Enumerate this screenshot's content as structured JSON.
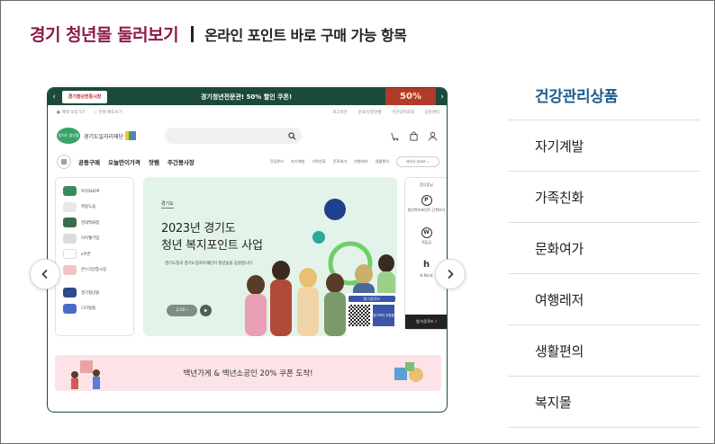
{
  "heading": {
    "title": "경기 청년몰 둘러보기",
    "subtitle": "온라인 포인트 바로 구매 가능 항목"
  },
  "carousel": {
    "prev_label": "‹",
    "next_label": "›",
    "screenshot": {
      "topbar": {
        "logo_text": "경기청년전통시장",
        "promo_text": "경기청년전문관! 50% 할인 쿠폰!",
        "promo_badge": "50%"
      },
      "utility_left": [
        "● 혜택 보증가기",
        "☆ 만원 페도보기"
      ],
      "utility_right": [
        "로그아웃",
        "문의/신청현황",
        "주문내역조회",
        "상담센터"
      ],
      "logo": {
        "badge": "경기도 청년몰",
        "name": "경기도일자리재단"
      },
      "nav_main": [
        "공동구매",
        "오늘만이가격",
        "찻템",
        "주간봉사장"
      ],
      "nav_sub": [
        "건강관리",
        "자기계발",
        "가족친화",
        "문화여가",
        "여행레저",
        "생활편의"
      ],
      "service_label": "서비스 zone ⌄",
      "sidebar": [
        {
          "label": "복지SHOP",
          "color": "#3a8b5a"
        },
        {
          "label": "위링도움",
          "color": "#e8e8e8"
        },
        {
          "label": "현대백화점",
          "color": "#3a6b4e"
        },
        {
          "label": "이지웰기업",
          "color": "#dcdcdc"
        },
        {
          "label": "e쿠폰",
          "color": "#ffffff"
        },
        {
          "label": "온누리전통시장",
          "color": "#f0c4c4"
        },
        {
          "label": "경기청년몰",
          "color": "#2e4a8c"
        },
        {
          "label": "디지털몰",
          "color": "#4a6cc4"
        }
      ],
      "hero": {
        "tag": "경기도",
        "title_line1": "2023년 경기도",
        "title_line2": "청년 복지포인트 사업",
        "desc": "경기도청과 경기도일자리재단이 청년들을 응원합니다.",
        "pager": "1/10 ›",
        "qr_title": "앱 다운로드",
        "qr_app": "경기복지 지원통"
      },
      "side_panel": {
        "title": "혼디혼님",
        "items": [
          "청년복지포인트 간편보기",
          "적립금",
          "H.Point"
        ],
        "icons": [
          "P",
          "W",
          "h"
        ],
        "bottom": "앱 다운로드 〉"
      },
      "banner_text": "백년가게 & 백년소공인 20% 쿠폰 도착!"
    }
  },
  "categories": [
    {
      "label": "건강관리상품",
      "active": true
    },
    {
      "label": "자기계발",
      "active": false
    },
    {
      "label": "가족친화",
      "active": false
    },
    {
      "label": "문화여가",
      "active": false
    },
    {
      "label": "여행레저",
      "active": false
    },
    {
      "label": "생활편의",
      "active": false
    },
    {
      "label": "복지몰",
      "active": false
    }
  ],
  "colors": {
    "title": "#8c1a4a",
    "active_category": "#1f5d8f",
    "topbar": "#1b4a3a",
    "hero_bg": "#e3f3ea",
    "banner_bg": "#fbe3e7"
  }
}
